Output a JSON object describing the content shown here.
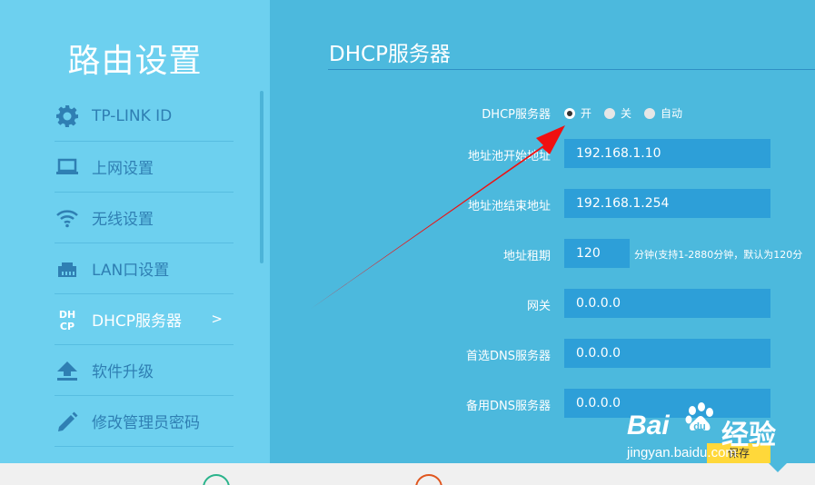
{
  "sidebar": {
    "title": "路由设置",
    "items": [
      {
        "label": "TP-LINK ID",
        "icon": "gear-icon"
      },
      {
        "label": "上网设置",
        "icon": "laptop-icon"
      },
      {
        "label": "无线设置",
        "icon": "wifi-icon"
      },
      {
        "label": "LAN口设置",
        "icon": "lan-port-icon"
      },
      {
        "label": "DHCP服务器",
        "icon": "dhcp-icon",
        "icon_text": "DHCP",
        "active": true,
        "chevron": ">"
      },
      {
        "label": "软件升级",
        "icon": "upload-icon"
      },
      {
        "label": "修改管理员密码",
        "icon": "pencil-icon"
      }
    ]
  },
  "main": {
    "title": "DHCP服务器",
    "dhcp_label": "DHCP服务器",
    "dhcp_options": [
      {
        "label": "开",
        "selected": true
      },
      {
        "label": "关",
        "selected": false
      },
      {
        "label": "自动",
        "selected": false
      }
    ],
    "fields": [
      {
        "label": "地址池开始地址",
        "value": "192.168.1.10"
      },
      {
        "label": "地址池结束地址",
        "value": "192.168.1.254"
      },
      {
        "label": "地址租期",
        "value": "120",
        "hint": "分钟(支持1-2880分钟，默认为120分"
      },
      {
        "label": "网关",
        "value": "0.0.0.0"
      },
      {
        "label": "首选DNS服务器",
        "value": "0.0.0.0"
      },
      {
        "label": "备用DNS服务器",
        "value": "0.0.0.0"
      }
    ],
    "save_label": "保存"
  },
  "watermark": {
    "brand": "Bai",
    "brand2": "du",
    "jingyan": "经验",
    "url": "jingyan.baidu.com"
  },
  "colors": {
    "sidebar_bg": "#6dd0ef",
    "main_bg": "#4cb9dd",
    "field_bg": "#2d9fd8",
    "arrow": "#f01010",
    "save_button": "#ffd83a"
  }
}
